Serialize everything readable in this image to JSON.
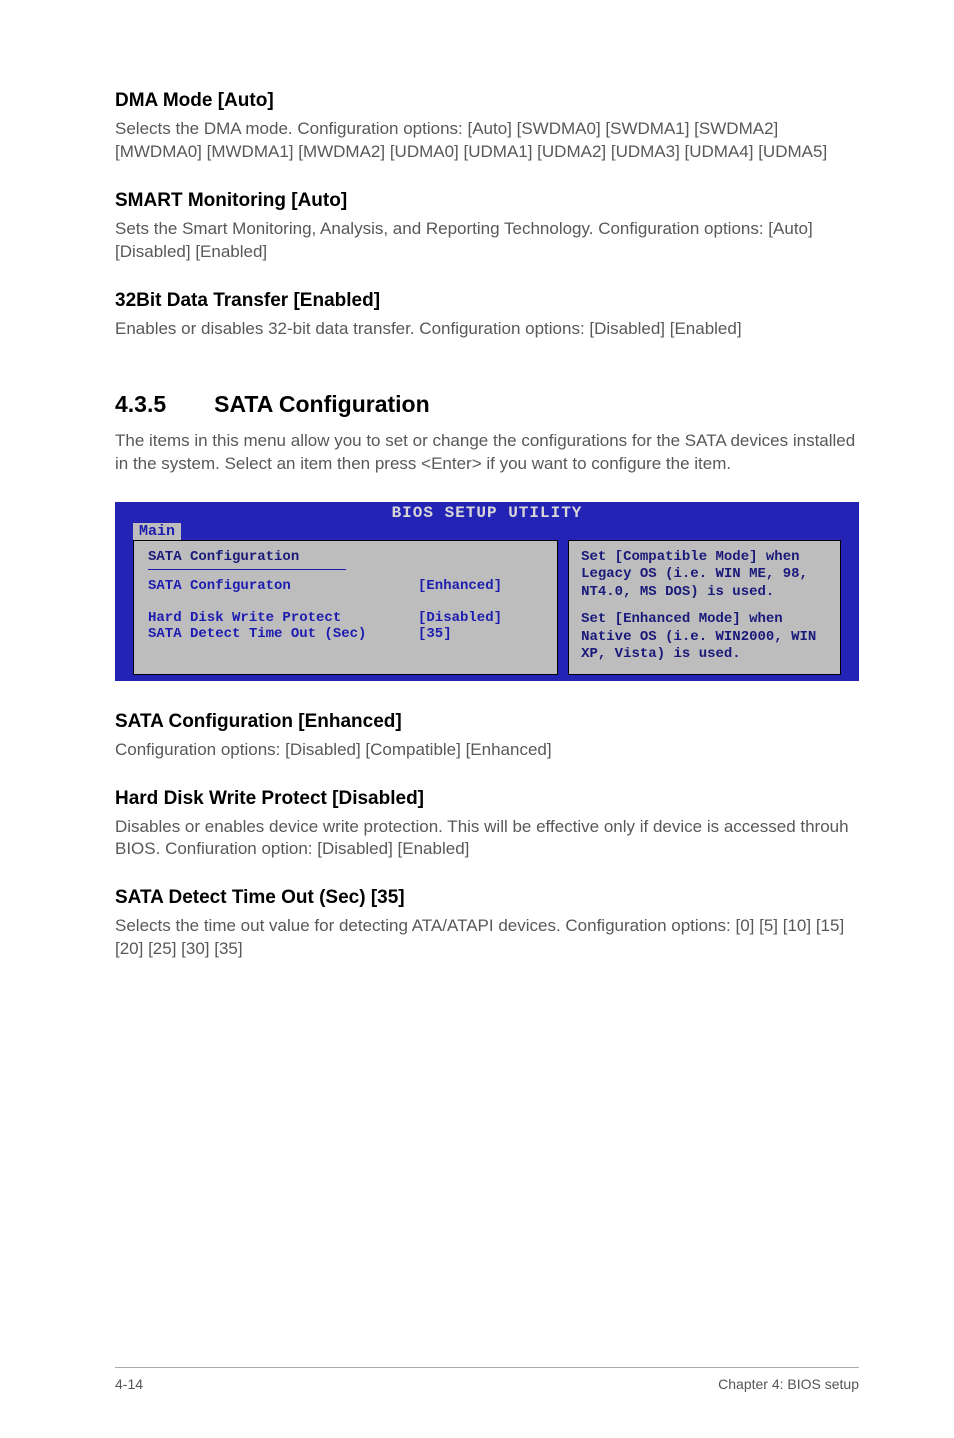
{
  "sec1": {
    "heading": "DMA Mode [Auto]",
    "body": "Selects the DMA mode. Configuration options: [Auto] [SWDMA0] [SWDMA1] [SWDMA2] [MWDMA0] [MWDMA1] [MWDMA2] [UDMA0] [UDMA1] [UDMA2] [UDMA3] [UDMA4] [UDMA5]"
  },
  "sec2": {
    "heading": "SMART Monitoring [Auto]",
    "body": "Sets the Smart Monitoring, Analysis, and Reporting Technology. Configuration options: [Auto] [Disabled] [Enabled]"
  },
  "sec3": {
    "heading": "32Bit Data Transfer [Enabled]",
    "body": "Enables or disables 32-bit data transfer. Configuration options: [Disabled] [Enabled]"
  },
  "main": {
    "num": "4.3.5",
    "title": "SATA Configuration",
    "body": "The items in this menu allow you to set or change the configurations for the SATA devices installed in the system. Select an item then press <Enter> if you want to configure the item."
  },
  "bios": {
    "title": "BIOS SETUP UTILITY",
    "tab": "Main",
    "panel_title": "SATA Configuration",
    "rows": [
      {
        "label": "SATA Configuraton",
        "value": "[Enhanced]"
      },
      {
        "label": "",
        "value": ""
      },
      {
        "label": "Hard Disk Write Protect",
        "value": "[Disabled]"
      },
      {
        "label": "SATA Detect Time Out (Sec)",
        "value": "[35]"
      }
    ],
    "help1": "Set [Compatible Mode] when Legacy OS (i.e. WIN ME, 98, NT4.0, MS DOS) is used.",
    "help2": "Set [Enhanced Mode] when Native OS (i.e. WIN2000, WIN XP, Vista) is used."
  },
  "sec4": {
    "heading": "SATA Configuration [Enhanced]",
    "body": "Configuration options: [Disabled] [Compatible] [Enhanced]"
  },
  "sec5": {
    "heading": "Hard Disk Write Protect [Disabled]",
    "body": "Disables or enables device write protection. This will be effective only if device is accessed throuh BIOS. Confiuration option: [Disabled] [Enabled]"
  },
  "sec6": {
    "heading": "SATA Detect Time Out (Sec) [35]",
    "body": "Selects the time out value for detecting ATA/ATAPI devices. Configuration options: [0] [5] [10] [15] [20] [25] [30] [35]"
  },
  "footer": {
    "left": "4-14",
    "right": "Chapter 4: BIOS setup"
  }
}
